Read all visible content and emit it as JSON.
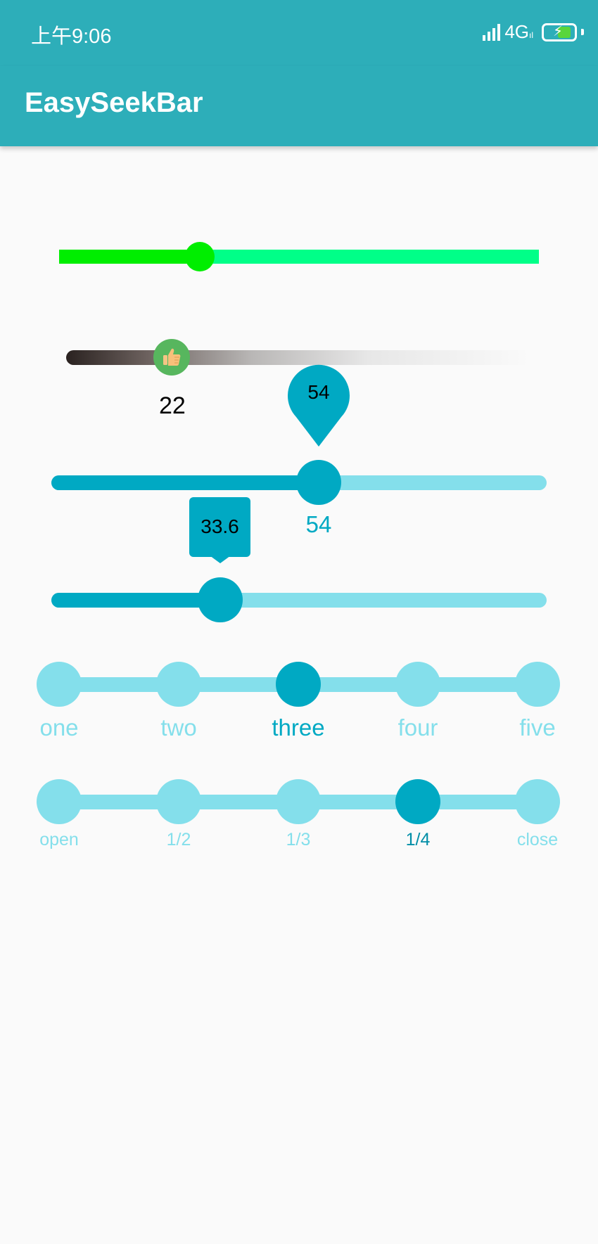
{
  "status_bar": {
    "time": "上午9:06",
    "network": "4G",
    "network_sub": "ıl"
  },
  "app_bar": {
    "title": "EasySeekBar"
  },
  "seekbars": {
    "basic": {
      "progress": 29,
      "track_color": "#00ff88",
      "progress_color": "#00ee00"
    },
    "gradient": {
      "value": "22",
      "progress": 22,
      "thumb_color": "#57b65e"
    },
    "pin": {
      "value": "54",
      "pin_label": "54",
      "progress": 54,
      "accent": "#00a9c3",
      "track_color": "#84dfeb"
    },
    "box": {
      "value": "33.6",
      "progress": 33.6,
      "accent": "#00a9c3"
    },
    "steps_words": {
      "options": [
        "one",
        "two",
        "three",
        "four",
        "five"
      ],
      "selected": "three"
    },
    "steps_fraction": {
      "options": [
        "open",
        "1/2",
        "1/3",
        "1/4",
        "close"
      ],
      "selected": "1/4"
    }
  }
}
